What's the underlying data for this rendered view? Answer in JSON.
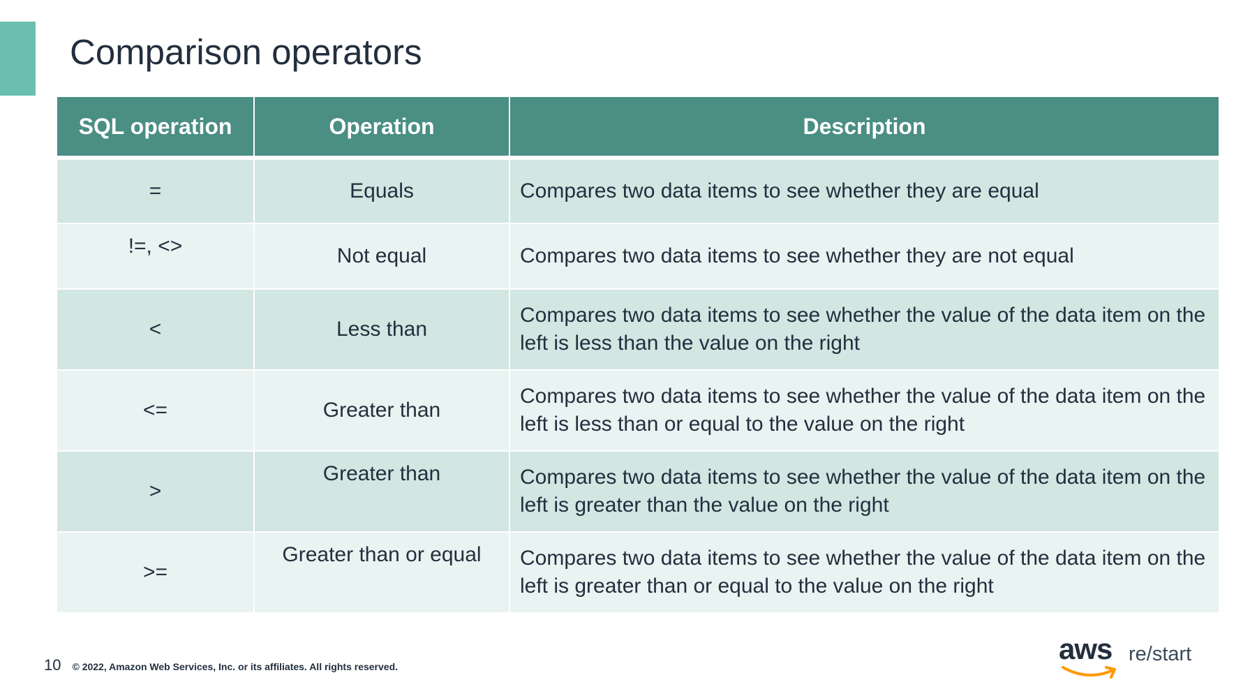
{
  "slide": {
    "title": "Comparison operators",
    "accent_color": "#6bbfb0",
    "header_color": "#4a8e84"
  },
  "table": {
    "headers": [
      "SQL operation",
      "Operation",
      "Description"
    ],
    "rows": [
      {
        "sql": "=",
        "operation": "Equals",
        "description": "Compares two data items to see whether they are equal"
      },
      {
        "sql": "!=, <>",
        "operation": "Not equal",
        "description": "Compares two data items to see whether they are not equal"
      },
      {
        "sql": "<",
        "operation": "Less than",
        "description": "Compares two data items to see whether the value of the data item on the left is less than the value on the right"
      },
      {
        "sql": "<=",
        "operation": "Greater than",
        "description": "Compares two data items to see whether the value of the data item on the left is less than or equal to the value on the right"
      },
      {
        "sql": ">",
        "operation": "Greater than",
        "description": "Compares two data items to see whether the value of the data item on the left is greater than the value on the right"
      },
      {
        "sql": ">=",
        "operation": "Greater than or equal",
        "description": "Compares two data items to see whether the value of the data item on the left is greater than or equal to the value on the right"
      }
    ]
  },
  "footer": {
    "page_number": "10",
    "copyright": "© 2022, Amazon Web Services, Inc. or its affiliates. All rights reserved."
  },
  "logo": {
    "aws": "aws",
    "product": "re/start",
    "smile_color": "#ff9900"
  }
}
